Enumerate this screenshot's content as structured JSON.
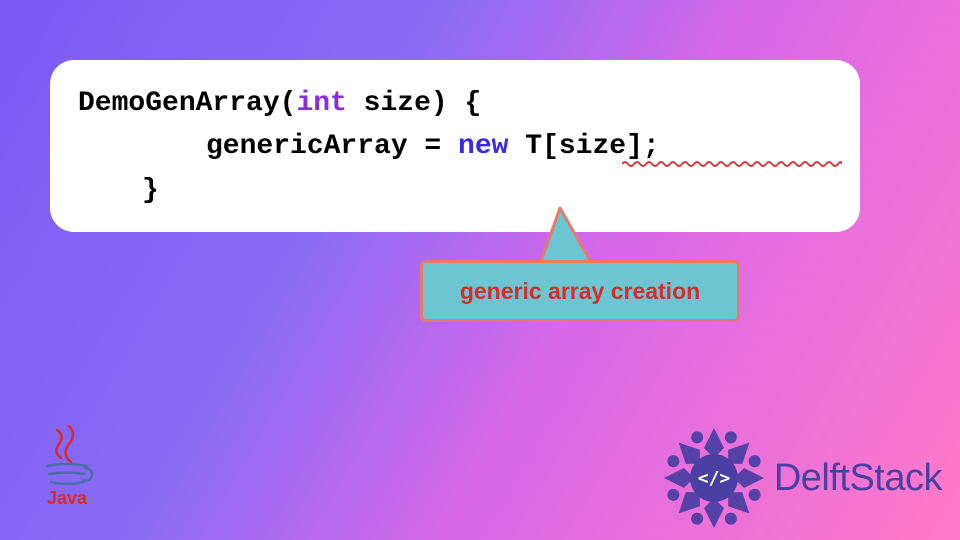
{
  "code": {
    "lines": [
      {
        "prefix": "DemoGenArray(",
        "type_kw": "int",
        "after_type": " size) {"
      },
      {
        "prefix": "genericArray = ",
        "new_kw": "new",
        "after_new": " T[size];"
      },
      {
        "text": "}"
      }
    ],
    "error_underline_color": "#d92b2b"
  },
  "callout": {
    "text": "generic array creation",
    "bg": "#6cc6d1",
    "border": "#e77a6a",
    "text_color": "#d92b2b"
  },
  "logos": {
    "java_label": "Java",
    "delft_label": "DelftStack"
  },
  "colors": {
    "gradient_start": "#7a5af5",
    "gradient_end": "#ff7ac8",
    "code_bg": "#ffffff",
    "keyword_type": "#8a2be2",
    "keyword_new": "#3a2ae2"
  }
}
